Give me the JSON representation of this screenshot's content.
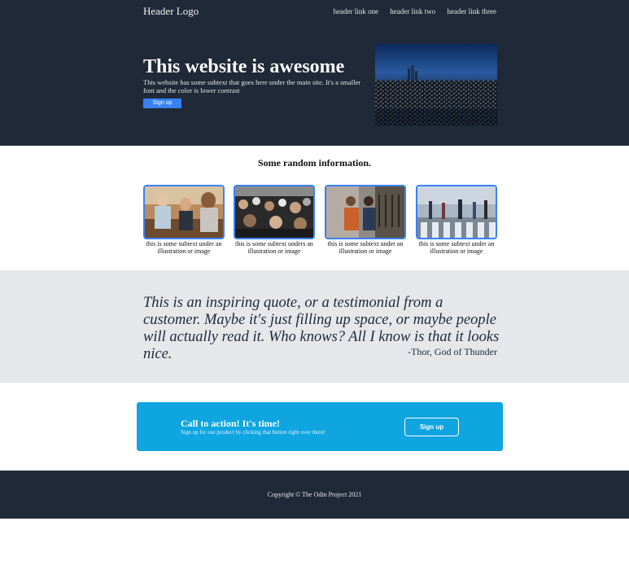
{
  "header": {
    "logo": "Header Logo",
    "links": [
      "header link one",
      "header link two",
      "header link three"
    ]
  },
  "hero": {
    "title": "This website is awesome",
    "subtext": "This website has some subtext that goes here under the main site. It's a smaller font and the color is lower contrast",
    "button_label": "Sign up",
    "image_icon": "city-night-skyline-image"
  },
  "info": {
    "title": "Some random information.",
    "cards": [
      {
        "text": "this is some subtext under an illustration or image",
        "image_icon": "friends-cafe-image"
      },
      {
        "text": "this is some subtext unders an illustration or image",
        "image_icon": "concert-crowd-image"
      },
      {
        "text": "this is some subtext under an illustration or image",
        "image_icon": "couple-street-image"
      },
      {
        "text": "this is some subtext under an illustration or image",
        "image_icon": "crosswalk-crowd-image"
      }
    ]
  },
  "quote": {
    "text": "This is an inspiring quote, or a testimonial from a customer. Maybe it's just filling up space, or maybe people will actually read it. Who knows? All I know is that it looks nice.",
    "author": "-Thor, God of Thunder"
  },
  "cta": {
    "title": "Call to action! It's time!",
    "subtext": "Sign up for our product by clicking that button right over there!",
    "button_label": "Sign up"
  },
  "footer": {
    "copyright": "Copyright © The Odin Project 2021"
  },
  "colors": {
    "dark": "#1f2937",
    "accent": "#3882f6",
    "cta": "#0ea5e1",
    "quote_band": "#e5e7eb"
  }
}
